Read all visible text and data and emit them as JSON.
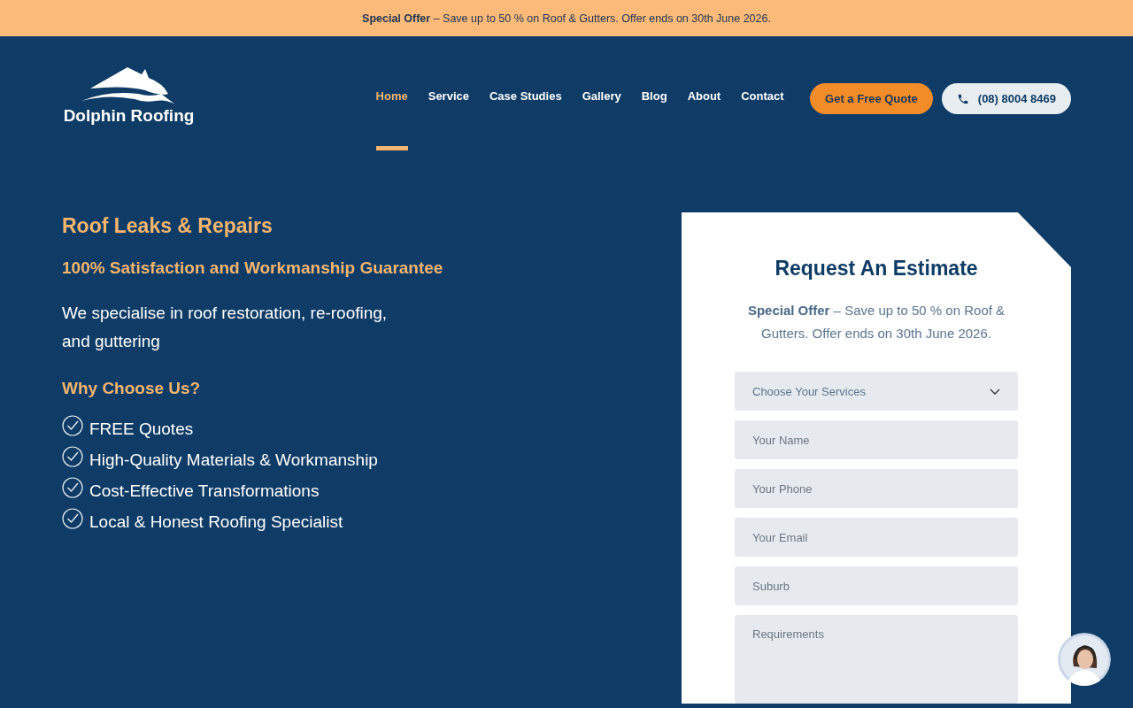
{
  "promo_bar": {
    "text": "**Special Offer** – Save up to 50 % on Roof & Gutters. Offer ends on 30th June 2026."
  },
  "header": {
    "logo_text": "Dolphin Roofing",
    "nav": [
      {
        "label": "Home",
        "selected": true
      },
      {
        "label": "Service",
        "selected": false
      },
      {
        "label": "Case Studies",
        "selected": false
      },
      {
        "label": "Gallery",
        "selected": false
      },
      {
        "label": "Blog",
        "selected": false
      },
      {
        "label": "About",
        "selected": false
      },
      {
        "label": "Contact",
        "selected": false
      }
    ],
    "quote_button": "Get a Free Quote",
    "phone_button": "(08) 8004 8469"
  },
  "hero": {
    "title": "Roof Leaks & Repairs",
    "subtitle": "100% Satisfaction and Workmanship Guarantee",
    "intro": "We specialise in roof restoration, re-roofing, and guttering",
    "why_title": "Why Choose Us?",
    "features": [
      "FREE Quotes",
      "High-Quality Materials & Workmanship",
      "Cost-Effective Transformations",
      "Local & Honest Roofing Specialist"
    ]
  },
  "estimate_form": {
    "title": "Request An Estimate",
    "offer": "**Special Offer** – Save up to 50 % on Roof & Gutters. Offer ends on 30th June 2026.",
    "fields": [
      {
        "kind": "select",
        "placeholder": "Choose Your Services"
      },
      {
        "kind": "input",
        "placeholder": "Your Name"
      },
      {
        "kind": "input",
        "placeholder": "Your Phone"
      },
      {
        "kind": "input",
        "placeholder": "Your Email"
      },
      {
        "kind": "input",
        "placeholder": "Suburb"
      },
      {
        "kind": "textarea",
        "placeholder": "Requirements"
      }
    ]
  }
}
